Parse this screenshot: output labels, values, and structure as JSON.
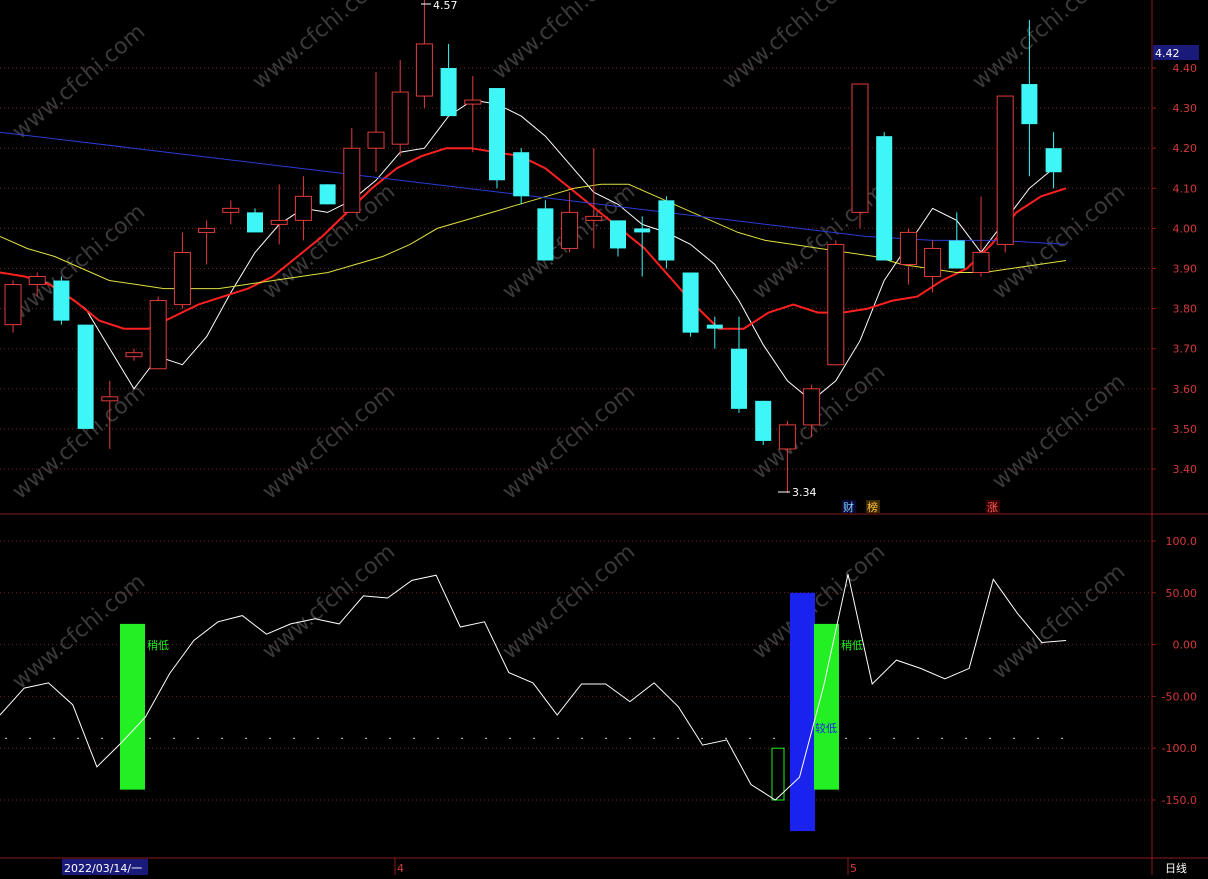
{
  "colors": {
    "background": "#000000",
    "frame": "#8b1a1a",
    "grid": "#7a1f1f",
    "axis_text": "#d23a3a",
    "up_candle": "#e23c3c",
    "down_candle": "#3ff6f6",
    "ma_white": "#ffffff",
    "ma_red": "#ff2020",
    "ma_yellow": "#e0e040",
    "ma_blue": "#2b3bd6",
    "osc_line": "#ffffff",
    "bar_green": "#22f022",
    "bar_blue": "#1a22ee",
    "current_price_bg": "#1a1a7a",
    "date_label_bg": "#1a1a7a"
  },
  "header": {
    "current_price": "4.42",
    "high_marker": "4.57",
    "low_marker": "3.34"
  },
  "markers": {
    "m1": "财",
    "m2": "榜",
    "m3": "涨"
  },
  "bottom_axis": {
    "start_date": "2022/03/14/一",
    "month1": "4",
    "month2": "5",
    "period": "日线"
  },
  "labels": {
    "signal1": "稍低",
    "signal2": "稍低",
    "signal3": "较低"
  },
  "watermark": "www.cfchi.com",
  "chart_data": [
    {
      "type": "candlestick",
      "title": "",
      "ylim": [
        3.28,
        4.62
      ],
      "yticks": [
        "4.40",
        "4.30",
        "4.20",
        "4.10",
        "4.00",
        "3.90",
        "3.80",
        "3.70",
        "3.60",
        "3.50",
        "3.40"
      ],
      "candles": [
        {
          "o": 3.76,
          "c": 3.86,
          "h": 3.87,
          "l": 3.74
        },
        {
          "o": 3.86,
          "c": 3.88,
          "h": 3.89,
          "l": 3.83
        },
        {
          "o": 3.87,
          "c": 3.77,
          "h": 3.88,
          "l": 3.76
        },
        {
          "o": 3.76,
          "c": 3.5,
          "h": 3.76,
          "l": 3.5
        },
        {
          "o": 3.57,
          "c": 3.58,
          "h": 3.62,
          "l": 3.45
        },
        {
          "o": 3.68,
          "c": 3.69,
          "h": 3.7,
          "l": 3.67
        },
        {
          "o": 3.65,
          "c": 3.82,
          "h": 3.83,
          "l": 3.65
        },
        {
          "o": 3.81,
          "c": 3.94,
          "h": 3.99,
          "l": 3.8
        },
        {
          "o": 3.99,
          "c": 4.0,
          "h": 4.02,
          "l": 3.91
        },
        {
          "o": 4.04,
          "c": 4.05,
          "h": 4.07,
          "l": 4.01
        },
        {
          "o": 4.04,
          "c": 3.99,
          "h": 4.05,
          "l": 3.99
        },
        {
          "o": 4.01,
          "c": 4.02,
          "h": 4.11,
          "l": 3.96
        },
        {
          "o": 4.02,
          "c": 4.08,
          "h": 4.13,
          "l": 3.97
        },
        {
          "o": 4.11,
          "c": 4.06,
          "h": 4.11,
          "l": 4.06
        },
        {
          "o": 4.04,
          "c": 4.2,
          "h": 4.25,
          "l": 4.04
        },
        {
          "o": 4.2,
          "c": 4.24,
          "h": 4.39,
          "l": 4.14
        },
        {
          "o": 4.21,
          "c": 4.34,
          "h": 4.42,
          "l": 4.18
        },
        {
          "o": 4.33,
          "c": 4.46,
          "h": 4.57,
          "l": 4.3
        },
        {
          "o": 4.4,
          "c": 4.28,
          "h": 4.46,
          "l": 4.28
        },
        {
          "o": 4.31,
          "c": 4.32,
          "h": 4.38,
          "l": 4.19
        },
        {
          "o": 4.35,
          "c": 4.12,
          "h": 4.35,
          "l": 4.1
        },
        {
          "o": 4.19,
          "c": 4.08,
          "h": 4.2,
          "l": 4.06
        },
        {
          "o": 4.05,
          "c": 3.92,
          "h": 4.07,
          "l": 3.92
        },
        {
          "o": 3.95,
          "c": 4.04,
          "h": 4.09,
          "l": 3.94
        },
        {
          "o": 4.02,
          "c": 4.03,
          "h": 4.2,
          "l": 3.95
        },
        {
          "o": 4.02,
          "c": 3.95,
          "h": 4.02,
          "l": 3.93
        },
        {
          "o": 4.0,
          "c": 3.99,
          "h": 4.03,
          "l": 3.88
        },
        {
          "o": 4.07,
          "c": 3.92,
          "h": 4.08,
          "l": 3.9
        },
        {
          "o": 3.89,
          "c": 3.74,
          "h": 3.89,
          "l": 3.73
        },
        {
          "o": 3.76,
          "c": 3.75,
          "h": 3.78,
          "l": 3.7
        },
        {
          "o": 3.7,
          "c": 3.55,
          "h": 3.78,
          "l": 3.54
        },
        {
          "o": 3.57,
          "c": 3.47,
          "h": 3.57,
          "l": 3.46
        },
        {
          "o": 3.45,
          "c": 3.51,
          "h": 3.52,
          "l": 3.34
        },
        {
          "o": 3.51,
          "c": 3.6,
          "h": 3.61,
          "l": 3.48
        },
        {
          "o": 3.66,
          "c": 3.96,
          "h": 3.97,
          "l": 3.66
        },
        {
          "o": 4.04,
          "c": 4.36,
          "h": 4.36,
          "l": 4.0
        },
        {
          "o": 4.23,
          "c": 3.92,
          "h": 4.24,
          "l": 3.92
        },
        {
          "o": 3.91,
          "c": 3.99,
          "h": 4.0,
          "l": 3.86
        },
        {
          "o": 3.88,
          "c": 3.95,
          "h": 3.97,
          "l": 3.84
        },
        {
          "o": 3.97,
          "c": 3.9,
          "h": 4.04,
          "l": 3.9
        },
        {
          "o": 3.89,
          "c": 3.94,
          "h": 4.08,
          "l": 3.88
        },
        {
          "o": 3.96,
          "c": 4.33,
          "h": 4.33,
          "l": 3.94
        },
        {
          "o": 4.36,
          "c": 4.26,
          "h": 4.52,
          "l": 4.13
        },
        {
          "o": 4.2,
          "c": 4.14,
          "h": 4.24,
          "l": 4.1
        }
      ],
      "series": [
        {
          "values": [
            3.88,
            3.84,
            3.8,
            3.7,
            3.6,
            3.68,
            3.66,
            3.73,
            3.84,
            3.94,
            4.01,
            4.05,
            4.04,
            4.07,
            4.12,
            4.19,
            4.2,
            4.28,
            4.32,
            4.31,
            4.28,
            4.23,
            4.16,
            4.09,
            4.06,
            4.01,
            3.99,
            3.96,
            3.91,
            3.82,
            3.71,
            3.62,
            3.57,
            3.62,
            3.72,
            3.87,
            3.96,
            4.05,
            4.02,
            3.94,
            4.02,
            4.1,
            4.15
          ]
        },
        {
          "values": [
            3.89,
            3.88,
            3.86,
            3.82,
            3.77,
            3.75,
            3.75,
            3.78,
            3.81,
            3.83,
            3.85,
            3.88,
            3.93,
            3.98,
            4.04,
            4.1,
            4.15,
            4.18,
            4.2,
            4.2,
            4.19,
            4.18,
            4.15,
            4.1,
            4.05,
            4.0,
            3.95,
            3.88,
            3.81,
            3.75,
            3.75,
            3.79,
            3.81,
            3.79,
            3.79,
            3.8,
            3.82,
            3.83,
            3.87,
            3.9,
            3.96,
            4.04,
            4.08,
            4.1
          ]
        },
        {
          "values": [
            3.98,
            3.95,
            3.93,
            3.9,
            3.87,
            3.86,
            3.85,
            3.85,
            3.85,
            3.86,
            3.87,
            3.88,
            3.89,
            3.91,
            3.93,
            3.96,
            4.0,
            4.02,
            4.04,
            4.06,
            4.08,
            4.1,
            4.11,
            4.11,
            4.08,
            4.05,
            4.02,
            3.99,
            3.97,
            3.96,
            3.95,
            3.94,
            3.93,
            3.91,
            3.9,
            3.89,
            3.89,
            3.9,
            3.91,
            3.92
          ]
        },
        {
          "values": [
            4.24,
            4.22,
            4.2,
            4.18,
            4.16,
            4.14,
            4.12,
            4.1,
            4.08,
            4.06,
            4.04,
            4.02,
            4.0,
            3.98,
            3.97,
            3.97,
            3.96
          ]
        }
      ]
    },
    {
      "type": "line",
      "title": "",
      "ylim": [
        -190,
        125
      ],
      "yticks": [
        "100.0",
        "50.00",
        "0.00",
        "-50.00",
        "-100.0",
        "-150.0"
      ],
      "series": [
        {
          "values": [
            -68,
            -42,
            -37,
            -58,
            -118,
            -95,
            -70,
            -28,
            4,
            22,
            28,
            10,
            20,
            25,
            20,
            47,
            45,
            62,
            67,
            17,
            22,
            -27,
            -37,
            -68,
            -38,
            -38,
            -55,
            -37,
            -60,
            -97,
            -92,
            -135,
            -150,
            -128,
            -40,
            68,
            -38,
            -15,
            -23,
            -33,
            -23,
            63,
            30,
            2,
            4
          ]
        }
      ],
      "signal_bars": [
        {
          "color": "green",
          "top": 20,
          "bottom": -140
        },
        {
          "color": "blue",
          "top": 50,
          "bottom": -180
        },
        {
          "color": "green",
          "top": 20,
          "bottom": -140
        }
      ]
    }
  ]
}
